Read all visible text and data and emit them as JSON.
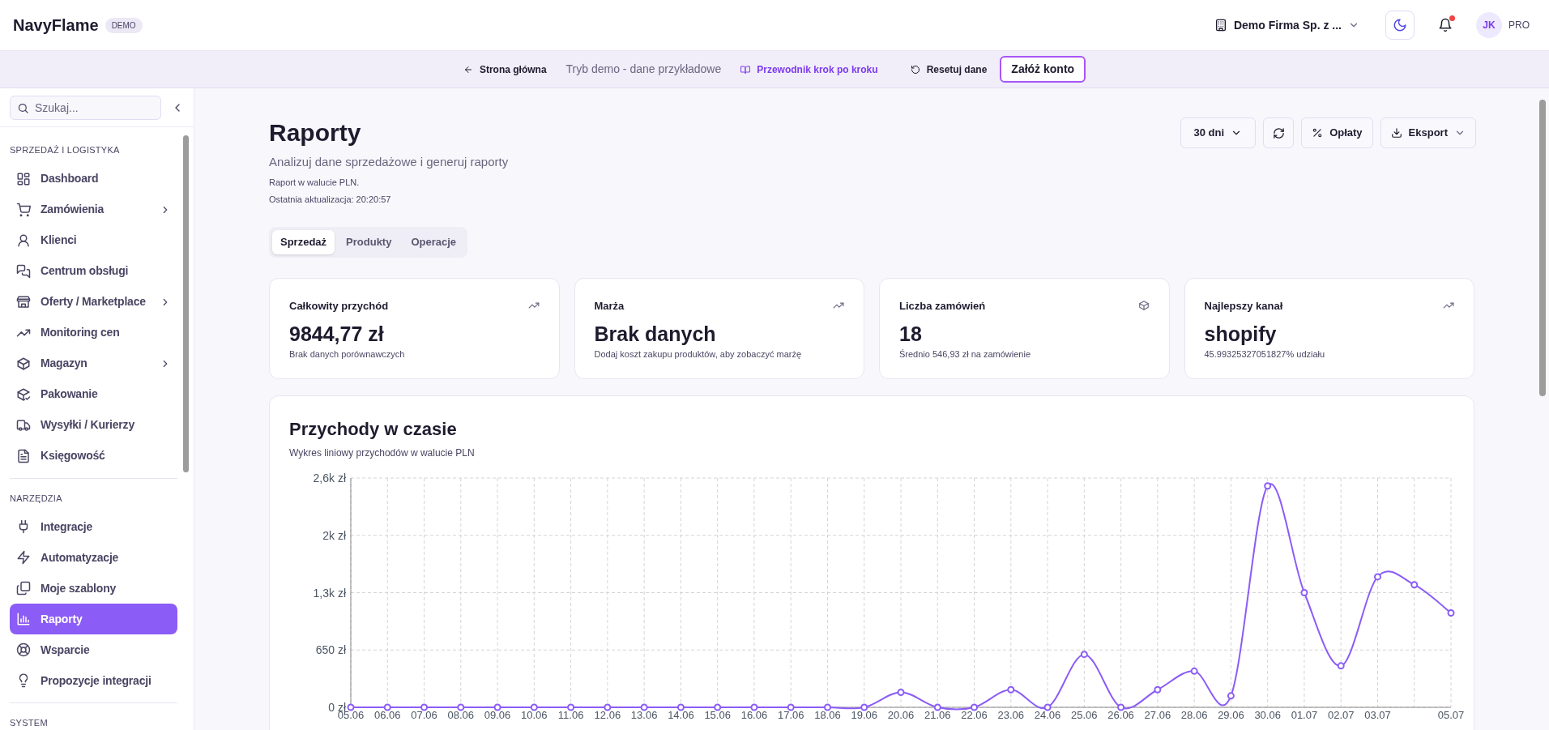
{
  "header": {
    "logo": "NavyFlame",
    "badge": "DEMO",
    "company": "Demo Firma Sp. z ...",
    "has_notifications": true,
    "avatar": "JK",
    "plan": "PRO"
  },
  "demo_bar": [
    {
      "kind": "back",
      "label": "Strona główna"
    },
    {
      "kind": "text",
      "label": "Tryb demo - dane przykładowe"
    },
    {
      "kind": "guide",
      "label": "Przewodnik krok po kroku"
    },
    {
      "kind": "reset",
      "label": "Resetuj dane"
    },
    {
      "kind": "signup",
      "label": "Załóż konto"
    }
  ],
  "sidebar": {
    "search": {
      "placeholder": "Szukaj..."
    },
    "sections": [
      {
        "title": "SPRZEDAŻ I LOGISTYKA",
        "items": [
          {
            "label": "Dashboard",
            "submenu": false,
            "selected": false
          },
          {
            "label": "Zamówienia",
            "submenu": true,
            "selected": false
          },
          {
            "label": "Klienci",
            "submenu": false,
            "selected": false
          },
          {
            "label": "Centrum obsługi",
            "submenu": false,
            "selected": false
          },
          {
            "label": "Oferty / Marketplace",
            "submenu": true,
            "selected": false
          },
          {
            "label": "Monitoring cen",
            "submenu": false,
            "selected": false
          },
          {
            "label": "Magazyn",
            "submenu": true,
            "selected": false
          },
          {
            "label": "Pakowanie",
            "submenu": false,
            "selected": false
          },
          {
            "label": "Wysyłki / Kurierzy",
            "submenu": false,
            "selected": false
          },
          {
            "label": "Księgowość",
            "submenu": false,
            "selected": false
          }
        ]
      },
      {
        "title": "NARZĘDZIA",
        "items": [
          {
            "label": "Integracje",
            "submenu": false,
            "selected": false
          },
          {
            "label": "Automatyzacje",
            "submenu": false,
            "selected": false
          },
          {
            "label": "Moje szablony",
            "submenu": false,
            "selected": false
          },
          {
            "label": "Raporty",
            "submenu": false,
            "selected": true
          },
          {
            "label": "Wsparcie",
            "submenu": false,
            "selected": false
          },
          {
            "label": "Propozycje integracji",
            "submenu": false,
            "selected": false
          }
        ]
      },
      {
        "title": "SYSTEM"
      }
    ]
  },
  "page": {
    "title": "Raporty",
    "subtitle": "Analizuj dane sprzedażowe i generuj raporty",
    "notes": [
      "Raport w walucie PLN.",
      "Ostatnia aktualizacja: 20:20:57"
    ]
  },
  "toolbar": [
    {
      "kind": "dropdown",
      "label": "30 dni"
    },
    {
      "kind": "refresh"
    },
    {
      "kind": "fees",
      "label": "Opłaty"
    },
    {
      "kind": "export",
      "label": "Eksport"
    }
  ],
  "tabs": [
    {
      "label": "Sprzedaż",
      "selected": true
    },
    {
      "label": "Produkty",
      "selected": false
    },
    {
      "label": "Operacje",
      "selected": false
    }
  ],
  "cards": [
    {
      "title": "Całkowity przychód",
      "value": "9844,77 zł",
      "note": "Brak danych porównawczych"
    },
    {
      "title": "Marża",
      "value": "Brak danych",
      "note": "Dodaj koszt zakupu produktów, aby zobaczyć marżę"
    },
    {
      "title": "Liczba zamówień",
      "value": "18",
      "note": "Średnio 546,93 zł na zamówienie"
    },
    {
      "title": "Najlepszy kanał",
      "value": "shopify",
      "note": "45.99325327051827% udziału"
    }
  ],
  "revenue_chart": {
    "title": "Przychody w czasie",
    "subtitle": "Wykres liniowy przychodów w walucie PLN",
    "chart_data": {
      "type": "line",
      "categories": [
        "05.06",
        "06.06",
        "07.06",
        "08.06",
        "09.06",
        "10.06",
        "11.06",
        "12.06",
        "13.06",
        "14.06",
        "15.06",
        "16.06",
        "17.06",
        "18.06",
        "19.06",
        "20.06",
        "21.06",
        "22.06",
        "23.06",
        "24.06",
        "25.06",
        "26.06",
        "27.06",
        "28.06",
        "29.06",
        "30.06",
        "01.07",
        "02.07",
        "03.07",
        null,
        "05.07"
      ],
      "grid": true,
      "series": [
        {
          "color": "#8b5cf6",
          "marker": true,
          "values": [
            0,
            0,
            0,
            0,
            0,
            0,
            0,
            0,
            0,
            0,
            0,
            0,
            0,
            0,
            0,
            170,
            0,
            0,
            200,
            0,
            600,
            0,
            200,
            410,
            130,
            2510,
            1300,
            470,
            1480,
            1390,
            1070
          ]
        }
      ],
      "ylim": [
        0,
        2600
      ],
      "yticks": [
        {
          "value": 0,
          "label": "0 zł"
        },
        {
          "value": 650,
          "label": "650 zł"
        },
        {
          "value": 1300,
          "label": "1,3k zł"
        },
        {
          "value": 1950,
          "label": "2k zł"
        },
        {
          "value": 2600,
          "label": "2,6k zł"
        }
      ]
    }
  }
}
